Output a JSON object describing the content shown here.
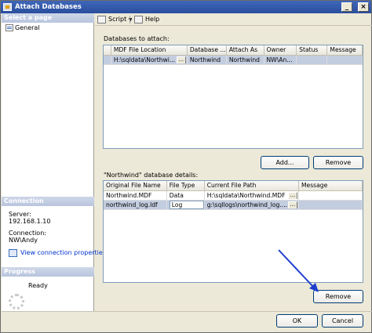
{
  "window": {
    "title": "Attach Databases"
  },
  "left_pane": {
    "select_page_header": "Select a page",
    "pages": [
      {
        "label": "General"
      }
    ],
    "connection_header": "Connection",
    "server_label": "Server:",
    "server_value": "192.168.1.10",
    "connection_label": "Connection:",
    "connection_value": "NW\\Andy",
    "view_connection_link": "View connection properties",
    "progress_header": "Progress",
    "progress_status": "Ready"
  },
  "toolbar": {
    "script_label": "Script",
    "help_label": "Help"
  },
  "databases_section": {
    "label": "Databases to attach:",
    "columns": [
      "MDF File Location",
      "Database ...",
      "Attach As",
      "Owner",
      "Status",
      "Message"
    ],
    "rows": [
      {
        "mdf": "H:\\sqldata\\Northwi...",
        "database": "Northwind",
        "attach_as": "Northwind",
        "owner": "NW\\An...",
        "status": "",
        "message": ""
      }
    ],
    "add_button": "Add...",
    "remove_button": "Remove"
  },
  "details_section": {
    "label": "\"Northwind\" database details:",
    "columns": [
      "Original File Name",
      "File Type",
      "Current File Path",
      "Message"
    ],
    "rows": [
      {
        "name": "Northwind.MDF",
        "type": "Data",
        "path": "H:\\sqldata\\Northwind.MDF",
        "message": ""
      },
      {
        "name": "northwind_log.ldf",
        "type": "Log",
        "path": "g:\\sqllogs\\northwind_log....",
        "message": ""
      }
    ],
    "remove_button": "Remove"
  },
  "footer": {
    "ok_button": "OK",
    "cancel_button": "Cancel"
  },
  "colors": {
    "title_bar": "#2a4e9d",
    "selected_row": "#c3cde0",
    "annotation_arrow": "#1e3fcf"
  }
}
